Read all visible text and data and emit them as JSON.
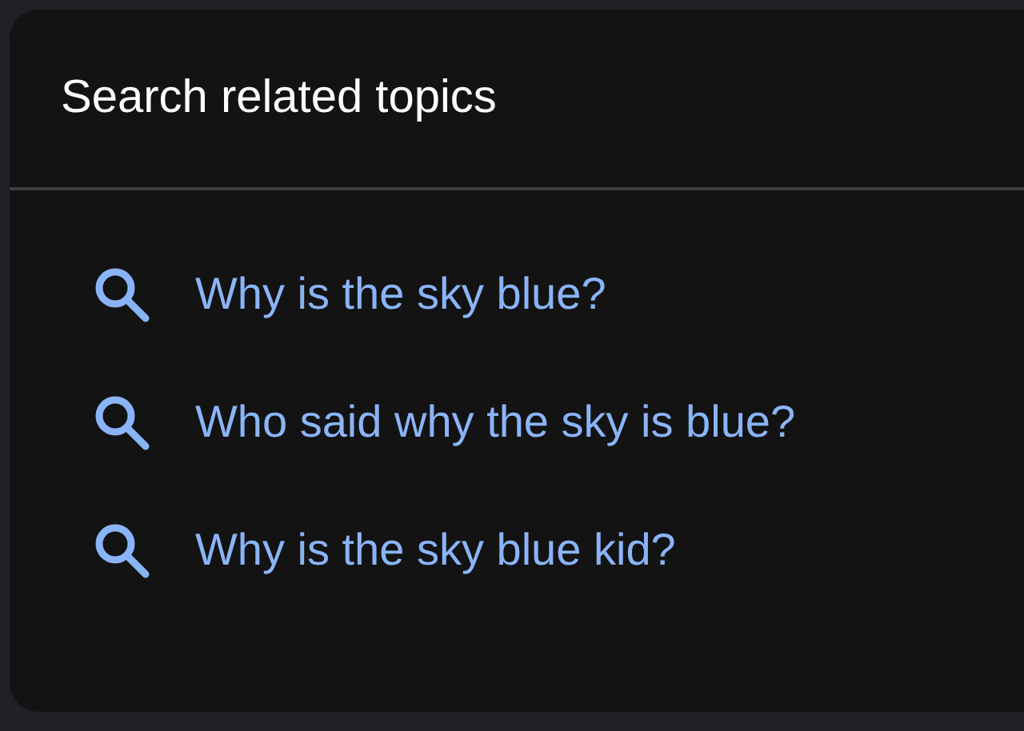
{
  "panel": {
    "title": "Search related topics",
    "suggestions": [
      {
        "text": "Why is the sky blue?"
      },
      {
        "text": "Who said why the sky is blue?"
      },
      {
        "text": "Why is the sky blue kid?"
      }
    ]
  }
}
